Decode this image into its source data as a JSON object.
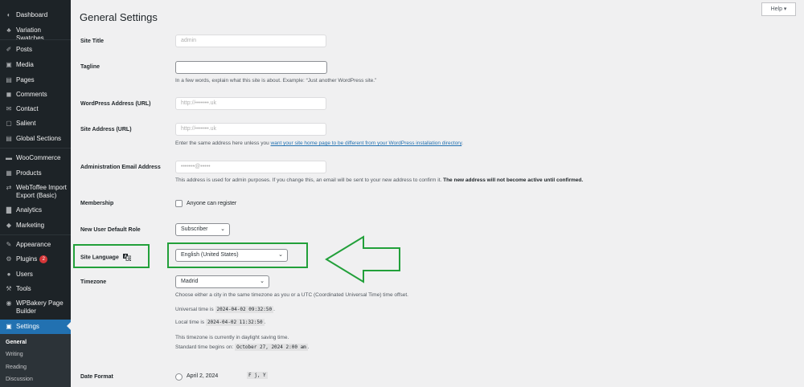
{
  "sidebar": {
    "items": [
      {
        "label": "Dashboard",
        "icon": "dashboard-icon",
        "glyph": "◐"
      },
      {
        "label": "Variation Swatches",
        "icon": "swatches-icon",
        "glyph": "♣"
      },
      {
        "label": "Posts",
        "icon": "pin-icon",
        "glyph": "✐"
      },
      {
        "label": "Media",
        "icon": "media-icon",
        "glyph": "▣"
      },
      {
        "label": "Pages",
        "icon": "pages-icon",
        "glyph": "▤"
      },
      {
        "label": "Comments",
        "icon": "comment-icon",
        "glyph": "◼"
      },
      {
        "label": "Contact",
        "icon": "envelope-icon",
        "glyph": "✉"
      },
      {
        "label": "Salient",
        "icon": "salient-icon",
        "glyph": "▢"
      },
      {
        "label": "Global Sections",
        "icon": "sections-icon",
        "glyph": "▤"
      },
      {
        "label": "WooCommerce",
        "icon": "woocommerce-icon",
        "glyph": "▬"
      },
      {
        "label": "Products",
        "icon": "products-icon",
        "glyph": "▦"
      },
      {
        "label": "WebToffee Import Export (Basic)",
        "icon": "import-export-icon",
        "glyph": "⇄"
      },
      {
        "label": "Analytics",
        "icon": "analytics-icon",
        "glyph": "▇"
      },
      {
        "label": "Marketing",
        "icon": "megaphone-icon",
        "glyph": "◆"
      },
      {
        "label": "Appearance",
        "icon": "brush-icon",
        "glyph": "✎"
      },
      {
        "label": "Plugins",
        "icon": "plugin-icon",
        "glyph": "⚙",
        "badge": "2"
      },
      {
        "label": "Users",
        "icon": "user-icon",
        "glyph": "●"
      },
      {
        "label": "Tools",
        "icon": "wrench-icon",
        "glyph": "⚒"
      },
      {
        "label": "WPBakery Page Builder",
        "icon": "wpbakery-icon",
        "glyph": "◉"
      },
      {
        "label": "Settings",
        "icon": "settings-icon",
        "glyph": "▣"
      }
    ],
    "submenu": [
      "General",
      "Writing",
      "Reading",
      "Discussion"
    ]
  },
  "page": {
    "title": "General Settings",
    "help": "Help ▾"
  },
  "form": {
    "site_title": {
      "label": "Site Title",
      "value": "admin"
    },
    "tagline": {
      "label": "Tagline",
      "value": "",
      "desc": "In a few words, explain what this site is about. Example: “Just another WordPress site.”"
    },
    "wp_address": {
      "label": "WordPress Address (URL)",
      "value": "http://•••••••.uk"
    },
    "site_address": {
      "label": "Site Address (URL)",
      "value": "http://•••••••.uk",
      "desc_pre": "Enter the same address here unless you ",
      "desc_link": "want your site home page to be different from your WordPress installation directory",
      "desc_post": "."
    },
    "admin_email": {
      "label": "Administration Email Address",
      "value": "•••••••@•••••",
      "desc_pre": "This address is used for admin purposes. If you change this, an email will be sent to your new address to confirm it. ",
      "desc_bold": "The new address will not become active until confirmed."
    },
    "membership": {
      "label": "Membership",
      "checkbox_label": "Anyone can register"
    },
    "default_role": {
      "label": "New User Default Role",
      "value": "Subscriber"
    },
    "site_language": {
      "label": "Site Language",
      "value": "English (United States)"
    },
    "timezone": {
      "label": "Timezone",
      "value": "Madrid",
      "desc": "Choose either a city in the same timezone as you or a UTC (Coordinated Universal Time) time offset.",
      "universal_label": "Universal time is",
      "universal_value": "2024-04-02 09:32:50",
      "local_label": "Local time is",
      "local_value": "2024-04-02 11:32:50",
      "dst_line": "This timezone is currently in daylight saving time.",
      "std_label": "Standard time begins on:",
      "std_value": "October 27, 2024 2:00 am"
    },
    "date_format": {
      "label": "Date Format",
      "option_label": "April 2, 2024",
      "option_code": "F j, Y"
    }
  },
  "annotation": {
    "color": "#22a03a"
  }
}
